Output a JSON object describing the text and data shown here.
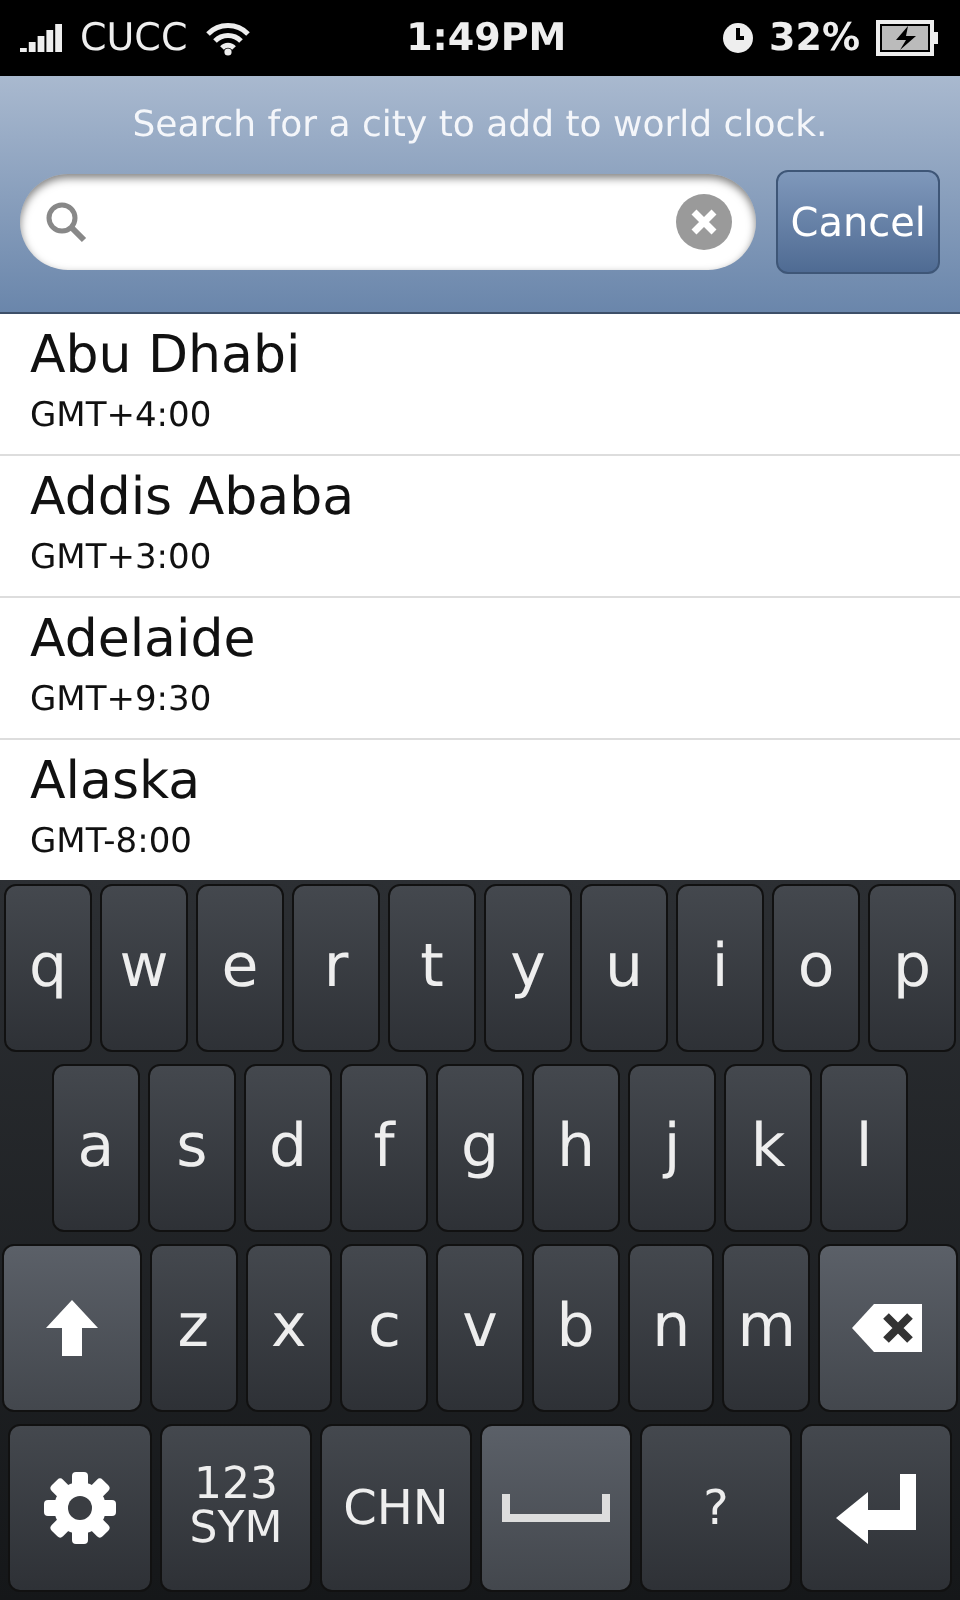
{
  "status_bar": {
    "carrier": "CUCC",
    "time": "1:49PM",
    "battery": "32%"
  },
  "header": {
    "prompt": "Search for a city to add to world clock.",
    "cancel": "Cancel"
  },
  "cities": [
    {
      "name": "Abu Dhabi",
      "offset": "GMT+4:00"
    },
    {
      "name": "Addis Ababa",
      "offset": "GMT+3:00"
    },
    {
      "name": "Adelaide",
      "offset": "GMT+9:30"
    },
    {
      "name": "Alaska",
      "offset": "GMT-8:00"
    }
  ],
  "keyboard": {
    "top_letters": [
      {
        "kind": "letter",
        "label": "q"
      },
      {
        "kind": "letter",
        "label": "w"
      },
      {
        "kind": "letter",
        "label": "e"
      },
      {
        "kind": "letter",
        "label": "r"
      },
      {
        "kind": "letter",
        "label": "t"
      },
      {
        "kind": "letter",
        "label": "y"
      },
      {
        "kind": "letter",
        "label": "u"
      },
      {
        "kind": "letter",
        "label": "i"
      },
      {
        "kind": "letter",
        "label": "o"
      },
      {
        "kind": "letter",
        "label": "p"
      }
    ],
    "middle_letters": [
      {
        "kind": "letter",
        "label": "a"
      },
      {
        "kind": "letter",
        "label": "s"
      },
      {
        "kind": "letter",
        "label": "d"
      },
      {
        "kind": "letter",
        "label": "f"
      },
      {
        "kind": "letter",
        "label": "g"
      },
      {
        "kind": "letter",
        "label": "h"
      },
      {
        "kind": "letter",
        "label": "j"
      },
      {
        "kind": "letter",
        "label": "k"
      },
      {
        "kind": "letter",
        "label": "l"
      }
    ],
    "bottom_letters": [
      {
        "kind": "shift"
      },
      {
        "kind": "letter",
        "label": "z"
      },
      {
        "kind": "letter",
        "label": "x"
      },
      {
        "kind": "letter",
        "label": "c"
      },
      {
        "kind": "letter",
        "label": "v"
      },
      {
        "kind": "letter",
        "label": "b"
      },
      {
        "kind": "letter",
        "label": "n"
      },
      {
        "kind": "letter",
        "label": "m"
      },
      {
        "kind": "backspace"
      }
    ],
    "function_keys": [
      {
        "kind": "settings"
      },
      {
        "kind": "mode",
        "label": "123",
        "sublabel": "SYM"
      },
      {
        "kind": "mode",
        "label": "CHN"
      },
      {
        "kind": "space"
      },
      {
        "kind": "mode",
        "label": "?"
      },
      {
        "kind": "enter"
      }
    ]
  }
}
